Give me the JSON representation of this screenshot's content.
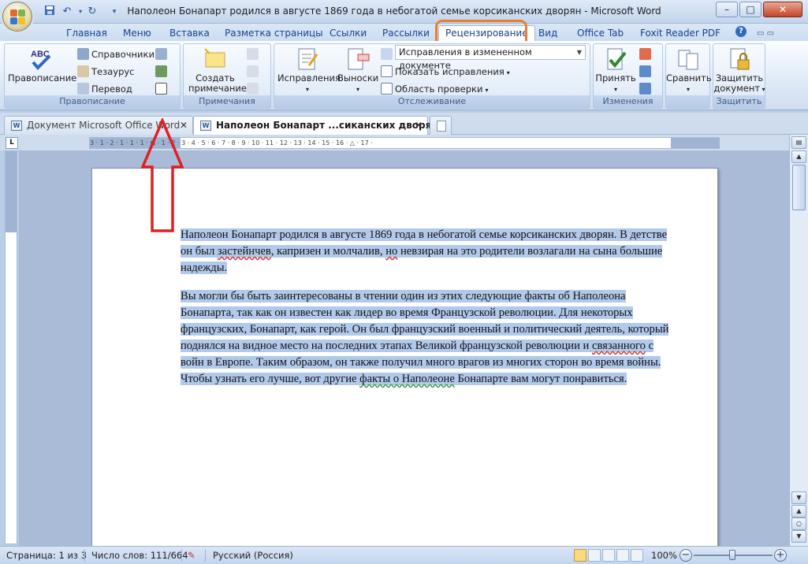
{
  "window": {
    "title": "Наполеон Бонапарт родился в августе 1869 года в небогатой семье корсиканских дворян - Microsoft Word",
    "controls": [
      "–",
      "□",
      "✕"
    ]
  },
  "quick_access": {
    "items": [
      "save-icon",
      "undo-icon",
      "redo-icon",
      "customize-icon"
    ]
  },
  "tabs": [
    {
      "label": "Главная"
    },
    {
      "label": "Меню"
    },
    {
      "label": "Вставка"
    },
    {
      "label": "Разметка страницы"
    },
    {
      "label": "Ссылки"
    },
    {
      "label": "Рассылки"
    },
    {
      "label": "Рецензирование",
      "active": true
    },
    {
      "label": "Вид"
    },
    {
      "label": "Office Tab"
    },
    {
      "label": "Foxit Reader PDF"
    }
  ],
  "ribbon": {
    "spelling": {
      "group_label": "Правописание",
      "spelling_button": "Правописание",
      "research": "Справочники",
      "thesaurus": "Тезаурус",
      "translate": "Перевод"
    },
    "comments": {
      "group_label": "Примечания",
      "new_comment_line1": "Создать",
      "new_comment_line2": "примечание"
    },
    "tracking": {
      "group_label": "Отслеживание",
      "track_changes": "Исправления",
      "balloons": "Выноски",
      "display_mode": "Исправления в измененном документе",
      "show_markup": "Показать исправления",
      "reviewing_pane": "Область проверки"
    },
    "changes": {
      "group_label": "Изменения",
      "accept": "Принять"
    },
    "compare": {
      "compare": "Сравнить"
    },
    "protect": {
      "group_label": "Защитить",
      "protect_line1": "Защитить",
      "protect_line2": "документ"
    }
  },
  "doc_tabs": [
    {
      "label": "Документ Microsoft Office Word",
      "close": "✕"
    },
    {
      "label": "Наполеон Бонапарт ...сиканских дворян *",
      "close": "✕",
      "active": true
    }
  ],
  "ruler": {
    "labels": "3 · 1 · 2 · 1 · 1 · 1 · ⊠ · 1 · 2 · 3 · 4 · 5 · 6 · 7 · 8 · 9 · 10 · 11 · 12 · 13 · 14 · 15 · 16 · △ · 17 ·",
    "corner": "L"
  },
  "document": {
    "paragraph1": {
      "s1": "Наполеон Бонапарт родился в августе 1869 года в небогатой семье корсиканских дворян. В детстве он был ",
      "w1": "застейнчев",
      "s2": ", капризен и молчалив, ",
      "w2": "но",
      "s3": " невзирая на это родители возлагали на сына большие надежды."
    },
    "paragraph2": {
      "s1": "Вы могли бы быть заинтересованы в чтении один из этих следующие факты об Наполеона Бонапарта, так как он известен как лидер во время Французской революции. Для некоторых французских, Бонапарт, как герой. Он был французский военный и политический деятель, который поднялся на видное место на последних этапах Великой французской революции и ",
      "w1": "связанного",
      "s2": " с войн в Европе. Таким образом, он также получил много врагов из многих сторон во время войны. Чтобы узнать его лучше, вот другие ",
      "w2": "факты о Наполеоне",
      "s3": " Бонапарте вам могут понравиться."
    }
  },
  "status": {
    "page": "Страница: 1 из 3",
    "words": "Число слов: 111/664",
    "language": "Русский (Россия)",
    "zoom": "100%",
    "zoom_out": "−",
    "zoom_in": "+"
  },
  "colors": {
    "selection": "#b1c9ea",
    "tab_highlight": "#f07c28",
    "annotation_arrow": "#e02020"
  }
}
